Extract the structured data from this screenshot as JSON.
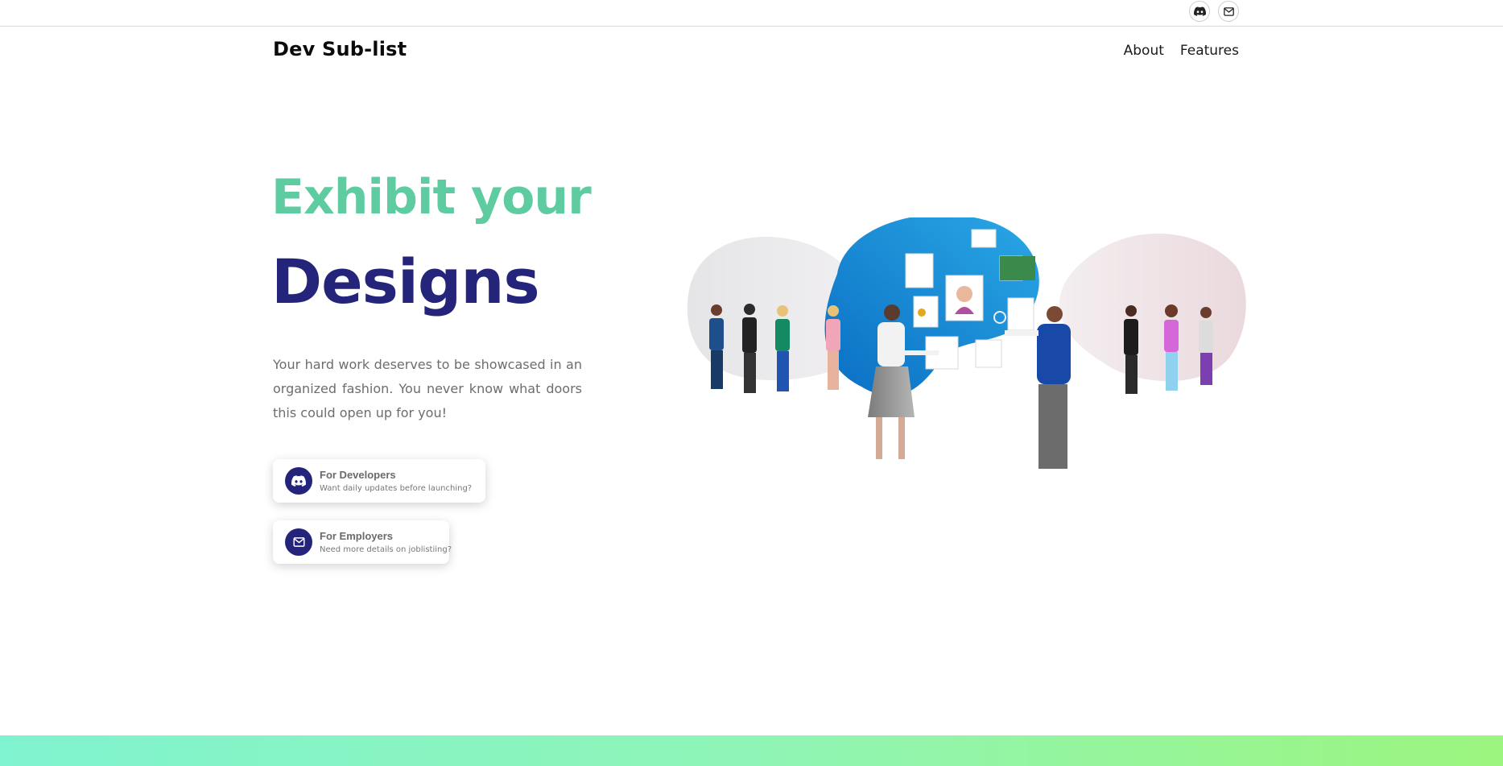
{
  "topbar": {
    "icons": [
      {
        "name": "discord-icon"
      },
      {
        "name": "mail-icon"
      }
    ]
  },
  "nav": {
    "brand": "Dev Sub-list",
    "links": [
      "About",
      "Features"
    ]
  },
  "hero": {
    "line1": "Exhibit your",
    "line2": "Designs",
    "description": "Your hard work deserves to be showcased in an organized fashion. You never know what doors this could open up for you!",
    "colors": {
      "line1": "#5ecba1",
      "line2": "#23247a",
      "accent": "#23247a"
    }
  },
  "cta": {
    "developers": {
      "title": "For Developers",
      "subtitle": "Want daily updates before launching?",
      "icon": "discord-icon"
    },
    "employers": {
      "title": "For Employers",
      "subtitle": "Need more details on joblistiing?",
      "icon": "mail-icon"
    }
  },
  "footer": {
    "gradient": [
      "#7ff3cf",
      "#9cf57e"
    ]
  }
}
